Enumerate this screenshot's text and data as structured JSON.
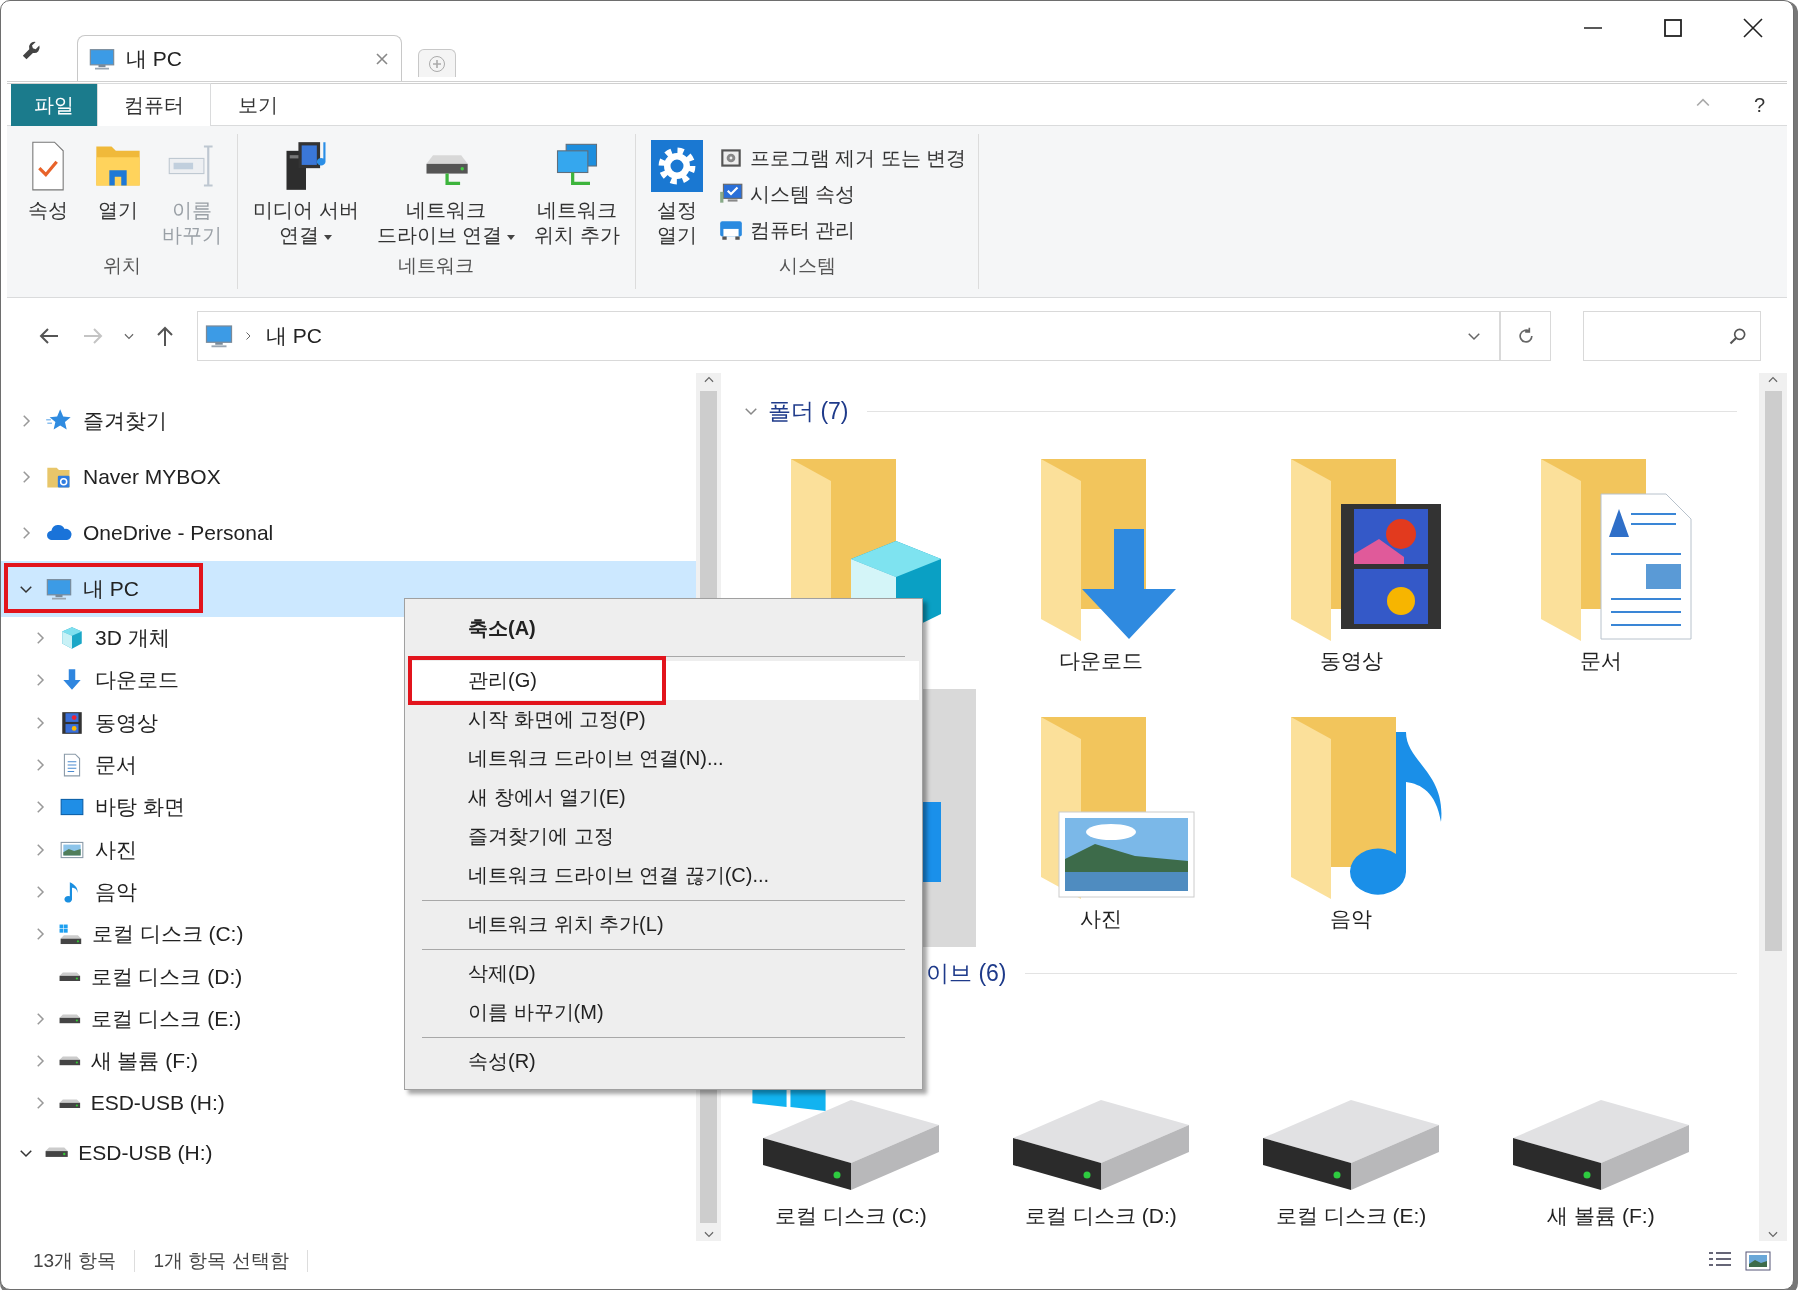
{
  "window": {
    "tab_title": "내 PC"
  },
  "ribbon": {
    "tabs": [
      {
        "label": "파일",
        "kind": "file",
        "selected": false
      },
      {
        "label": "컴퓨터",
        "kind": "tab",
        "selected": true
      },
      {
        "label": "보기",
        "kind": "tab",
        "selected": false
      }
    ],
    "help_button": "?",
    "groups": [
      {
        "label": "위치",
        "buttons": [
          {
            "label": "속성",
            "kind": "large",
            "disabled": false,
            "dropdown": false
          },
          {
            "label": "열기",
            "kind": "large",
            "disabled": false,
            "dropdown": false
          },
          {
            "label": "이름\n바꾸기",
            "kind": "large",
            "disabled": true,
            "dropdown": false
          }
        ]
      },
      {
        "label": "네트워크",
        "buttons": [
          {
            "label": "미디어 서버\n연결",
            "kind": "large",
            "disabled": false,
            "dropdown": true
          },
          {
            "label": "네트워크\n드라이브 연결",
            "kind": "large",
            "disabled": false,
            "dropdown": true
          },
          {
            "label": "네트워크\n위치 추가",
            "kind": "large",
            "disabled": false,
            "dropdown": false
          }
        ]
      },
      {
        "label": "시스템",
        "buttons": [
          {
            "label": "설정\n열기",
            "kind": "large",
            "disabled": false,
            "dropdown": false
          },
          {
            "label": "프로그램 제거 또는 변경",
            "kind": "small",
            "disabled": false,
            "dropdown": false
          },
          {
            "label": "시스템 속성",
            "kind": "small",
            "disabled": false,
            "dropdown": false
          },
          {
            "label": "컴퓨터 관리",
            "kind": "small",
            "disabled": false,
            "dropdown": false
          }
        ]
      }
    ]
  },
  "address": {
    "forward_disabled": true,
    "path": [
      "내 PC"
    ]
  },
  "tree": {
    "items": [
      {
        "label": "즐겨찾기",
        "expandable": true,
        "expanded": false,
        "selected": false,
        "annotated": false
      },
      {
        "label": "Naver MYBOX",
        "expandable": true,
        "expanded": false,
        "selected": false,
        "annotated": false
      },
      {
        "label": "OneDrive - Personal",
        "expandable": true,
        "expanded": false,
        "selected": false,
        "annotated": false
      },
      {
        "label": "내 PC",
        "expandable": true,
        "expanded": true,
        "selected": true,
        "annotated": true,
        "children": [
          {
            "label": "3D 개체",
            "expandable": true,
            "selected": false
          },
          {
            "label": "다운로드",
            "expandable": true,
            "selected": false
          },
          {
            "label": "동영상",
            "expandable": true,
            "selected": false
          },
          {
            "label": "문서",
            "expandable": true,
            "selected": false
          },
          {
            "label": "바탕 화면",
            "expandable": true,
            "selected": false
          },
          {
            "label": "사진",
            "expandable": true,
            "selected": false
          },
          {
            "label": "음악",
            "expandable": true,
            "selected": false
          },
          {
            "label": "로컬 디스크 (C:)",
            "expandable": true,
            "selected": false
          },
          {
            "label": "로컬 디스크 (D:)",
            "expandable": false,
            "selected": false
          },
          {
            "label": "로컬 디스크 (E:)",
            "expandable": true,
            "selected": false
          },
          {
            "label": "새 볼륨 (F:)",
            "expandable": true,
            "selected": false
          },
          {
            "label": "ESD-USB (H:)",
            "expandable": true,
            "selected": false
          }
        ]
      },
      {
        "label": "ESD-USB (H:)",
        "expandable": true,
        "expanded": true,
        "selected": false,
        "annotated": false
      }
    ]
  },
  "main": {
    "groups": [
      {
        "header": "폴더 (7)",
        "items": [
          {
            "selected": false
          },
          {
            "label": "다운로드",
            "selected": false
          },
          {
            "label": "동영상",
            "selected": false
          },
          {
            "label": "문서",
            "selected": false
          },
          {
            "selected": true
          },
          {
            "label": "사진",
            "selected": false
          },
          {
            "label": "음악",
            "selected": false
          }
        ]
      },
      {
        "header": "이브 (6)",
        "items": [
          {
            "label": "로컬 디스크 (C:)",
            "selected": false
          },
          {
            "label": "로컬 디스크 (D:)",
            "selected": false
          },
          {
            "label": "로컬 디스크 (E:)",
            "selected": false
          },
          {
            "label": "새 볼륨 (F:)",
            "selected": false
          }
        ]
      }
    ]
  },
  "context_menu": {
    "items": [
      {
        "kind": "item",
        "label": "축소(A)",
        "default": true,
        "selected": false,
        "annotated": false
      },
      {
        "kind": "separator"
      },
      {
        "kind": "item",
        "label": "관리(G)",
        "default": false,
        "selected": true,
        "annotated": true
      },
      {
        "kind": "item",
        "label": "시작 화면에 고정(P)",
        "default": false,
        "selected": false,
        "annotated": false
      },
      {
        "kind": "item",
        "label": "네트워크 드라이브 연결(N)...",
        "default": false,
        "selected": false,
        "annotated": false
      },
      {
        "kind": "item",
        "label": "새 창에서 열기(E)",
        "default": false,
        "selected": false,
        "annotated": false
      },
      {
        "kind": "item",
        "label": "즐겨찾기에 고정",
        "default": false,
        "selected": false,
        "annotated": false
      },
      {
        "kind": "item",
        "label": "네트워크 드라이브 연결 끊기(C)...",
        "default": false,
        "selected": false,
        "annotated": false
      },
      {
        "kind": "separator"
      },
      {
        "kind": "item",
        "label": "네트워크 위치 추가(L)",
        "default": false,
        "selected": false,
        "annotated": false
      },
      {
        "kind": "separator"
      },
      {
        "kind": "item",
        "label": "삭제(D)",
        "default": false,
        "selected": false,
        "annotated": false
      },
      {
        "kind": "item",
        "label": "이름 바꾸기(M)",
        "default": false,
        "selected": false,
        "annotated": false
      },
      {
        "kind": "separator"
      },
      {
        "kind": "item",
        "label": "속성(R)",
        "default": false,
        "selected": false,
        "annotated": false
      }
    ]
  },
  "status_bar": {
    "items": [
      "13개 항목",
      "1개 항목 선택함"
    ]
  }
}
